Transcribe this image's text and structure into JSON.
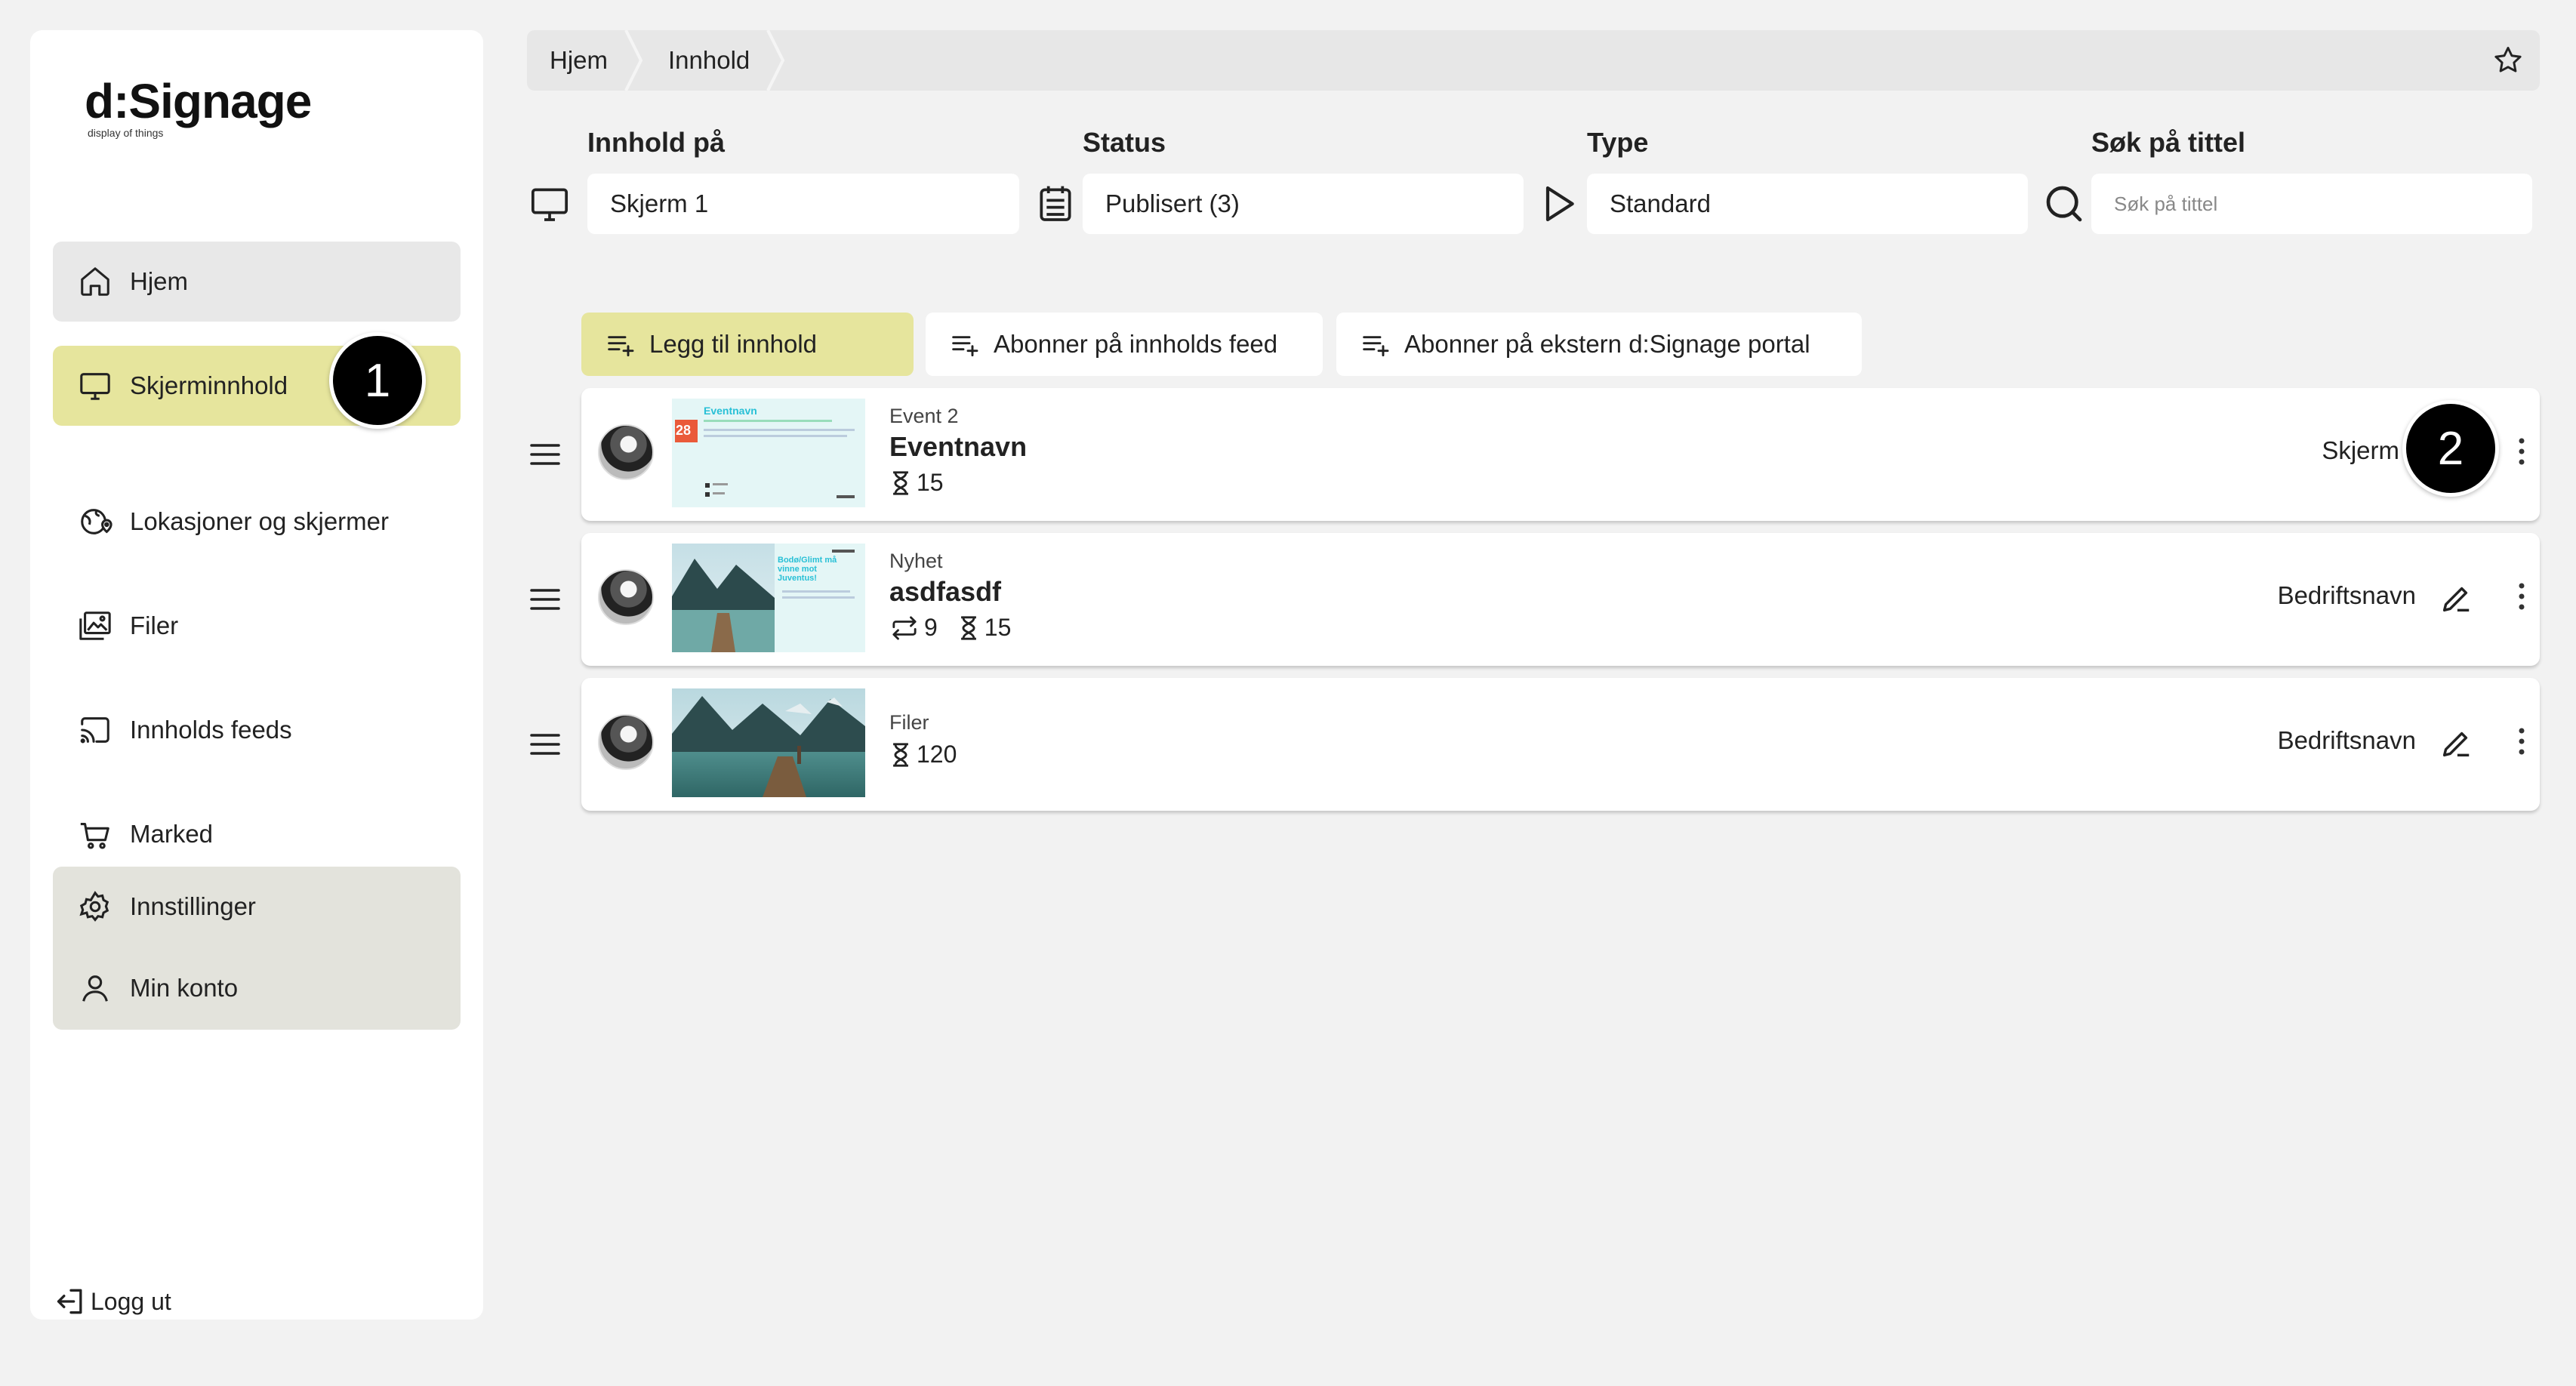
{
  "logo": {
    "main": "d:Signage",
    "tagline": "display of things"
  },
  "sidebar": {
    "items": [
      {
        "label": "Hjem",
        "icon": "home-icon"
      },
      {
        "label": "Skjerminnhold",
        "icon": "monitor-icon"
      },
      {
        "label": "Lokasjoner og skjermer",
        "icon": "location-globe-icon"
      },
      {
        "label": "Filer",
        "icon": "images-icon"
      },
      {
        "label": "Innholds feeds",
        "icon": "cast-icon"
      },
      {
        "label": "Marked",
        "icon": "cart-icon"
      }
    ],
    "settings": [
      {
        "label": "Innstillinger",
        "icon": "gear-icon"
      },
      {
        "label": "Min konto",
        "icon": "user-icon"
      }
    ],
    "logout_label": "Logg ut"
  },
  "callouts": {
    "first": "1",
    "second": "2"
  },
  "breadcrumb": [
    "Hjem",
    "Innhold"
  ],
  "filters": {
    "content_on": {
      "label": "Innhold på",
      "value": "Skjerm 1"
    },
    "status": {
      "label": "Status",
      "value": "Publisert (3)"
    },
    "type": {
      "label": "Type",
      "value": "Standard"
    },
    "search": {
      "label": "Søk på tittel",
      "placeholder": "Søk på tittel"
    }
  },
  "actions": {
    "add": "Legg til innhold",
    "subscribe_feed": "Abonner på innholds feed",
    "subscribe_portal": "Abonner på ekstern d:Signage portal"
  },
  "rows": [
    {
      "type": "Event 2",
      "title": "Eventnavn",
      "duration": "15",
      "owner": "Skjerm",
      "thumb_title": "Eventnavn",
      "thumb_day": "28"
    },
    {
      "type": "Nyhet",
      "title": "asdfasdf",
      "repeat": "9",
      "duration": "15",
      "owner": "Bedriftsnavn",
      "thumb_title": "Bodø/Glimt må vinne mot Juventus!"
    },
    {
      "type": "Filer",
      "title": "",
      "duration": "120",
      "owner": "Bedriftsnavn"
    }
  ],
  "colors": {
    "accent": "#e6e59d",
    "background": "#f2f2f2",
    "home_bg": "#e8e8e8",
    "settings_bg": "#e3e3dc"
  }
}
